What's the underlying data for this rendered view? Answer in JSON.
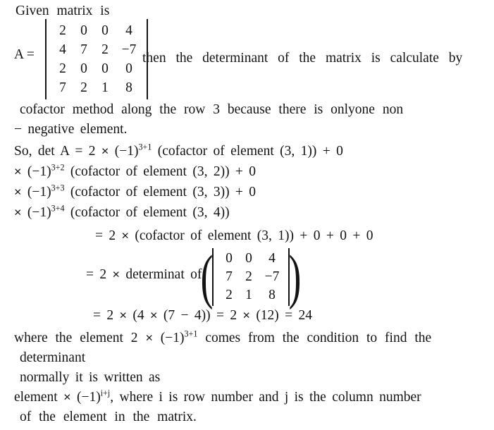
{
  "document": {
    "type": "handwritten-style math solution",
    "topic": "Determinant of a 4x4 matrix by cofactor expansion"
  },
  "lines": {
    "l1": "Given  matrix  is",
    "matrix_label": "A =",
    "l2_right": "then  the   determinant  of  the  matrix  is  calculate  by",
    "l3": "cofactor  method  along  the  row 3 because  there  is  onlyone  non",
    "l4": "− negative  element.",
    "l5_pre": "So,  det A = 2 ",
    "l5_mid": " (−1)",
    "l5_sup": "3+1",
    "l5_post": " (cofactor  of  element  (3, 1)) + 0",
    "l6_pre": " (−1)",
    "l6_sup": "3+2",
    "l6_post": " (cofactor  of  element  (3, 2)) + 0",
    "l7_sup": "3+3",
    "l7_post": " (cofactor  of  element  (3, 3)) + 0",
    "l8_sup": "3+4",
    "l8_post": " (cofactor  of  element  (3, 4))",
    "l9_pre": "= 2 ",
    "l9_post": " (cofactor  of  element  (3, 1)) + 0 + 0 + 0",
    "l10_pre": "= 2 ",
    "l10_post": " determinat  of",
    "l11_pre": "= 2 ",
    "l11_mid": " (4 ",
    "l11_mid2": " (7 − 4)) = 2 ",
    "l11_post": " (12) = 24",
    "l12_pre": "where  the  element  2 ",
    "l12_mid": " (−1)",
    "l12_sup": "3+1",
    "l12_post": "  comes  from  the  condition  to  find  the",
    "l13": "determinant",
    "l14": "normally  it  is  written  as",
    "l15_pre": "element ",
    "l15_mid": " (−1)",
    "l15_sup": "i+j",
    "l15_post": ",    where i  is  row  number  and j  is  the  column  number",
    "l16": "of  the  element  in  the  matrix.",
    "multiply_sign": "×"
  },
  "matrix_a": {
    "name": "A",
    "delimiter": "vertical-bars",
    "rows": [
      [
        "2",
        "0",
        "0",
        "4"
      ],
      [
        "4",
        "7",
        "2",
        "−7"
      ],
      [
        "2",
        "0",
        "0",
        "0"
      ],
      [
        "7",
        "2",
        "1",
        "8"
      ]
    ]
  },
  "matrix_minor": {
    "name": "minor of element (3,1)",
    "delimiter": "paren-and-bars",
    "rows": [
      [
        "0",
        "0",
        "4"
      ],
      [
        "7",
        "2",
        "−7"
      ],
      [
        "2",
        "1",
        "8"
      ]
    ]
  },
  "colors": {
    "background": "#ffffff",
    "text": "#131313"
  }
}
